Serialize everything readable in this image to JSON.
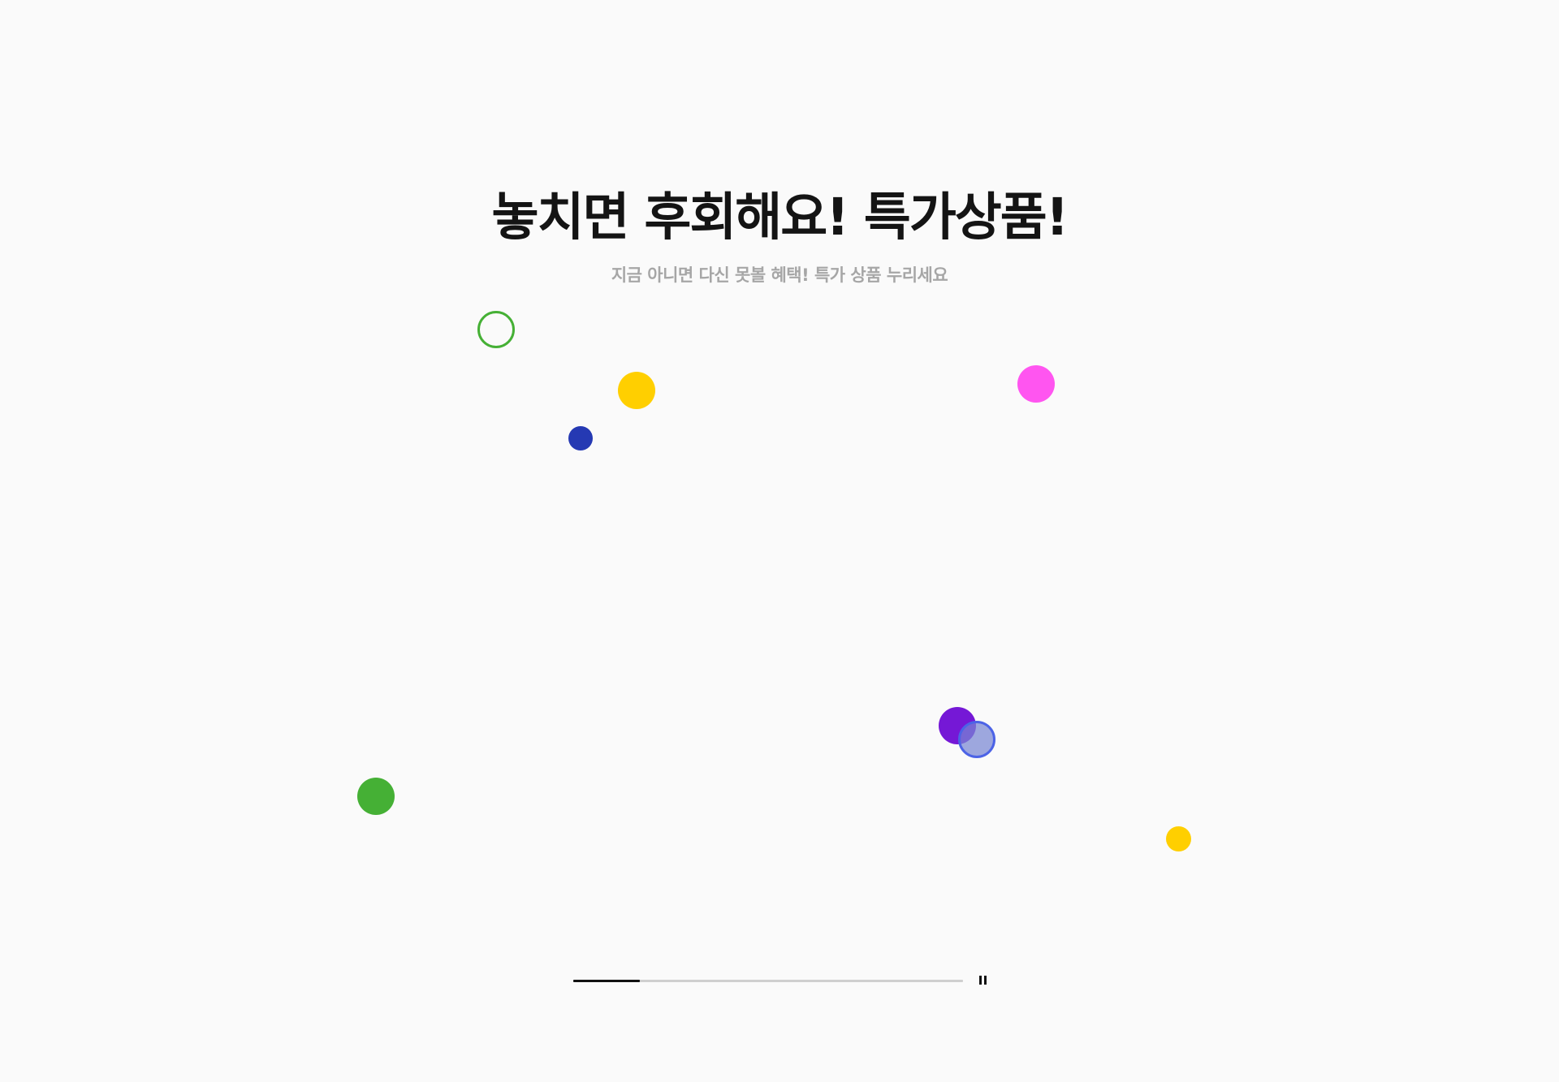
{
  "hero": {
    "title": "놓치면 후회해요! 특가상품!",
    "subtitle": "지금 아니면 다신 못볼 혜택! 특가 상품 누리세요"
  },
  "decorations": {
    "dots": [
      {
        "name": "ring-green-dot",
        "style": "ring",
        "color": "#45b035",
        "fill": "transparent"
      },
      {
        "name": "yellow-dot-large",
        "style": "filled",
        "color": "#ffcf00"
      },
      {
        "name": "navy-dot",
        "style": "filled",
        "color": "#2539b3"
      },
      {
        "name": "magenta-dot",
        "style": "filled",
        "color": "#ff55f0"
      },
      {
        "name": "purple-dot",
        "style": "filled",
        "color": "#7518d6"
      },
      {
        "name": "translucent-blue-dot",
        "style": "ring",
        "color": "#4c63e6",
        "fill": "rgba(120,135,210,0.72)"
      },
      {
        "name": "green-dot",
        "style": "filled",
        "color": "#45b035"
      },
      {
        "name": "yellow-dot-small",
        "style": "filled",
        "color": "#ffcf00"
      }
    ]
  },
  "slider": {
    "progress": 0.17,
    "track_color": "#cfcfcf",
    "fill_color": "#111111",
    "control_icon": "pause-icon"
  }
}
